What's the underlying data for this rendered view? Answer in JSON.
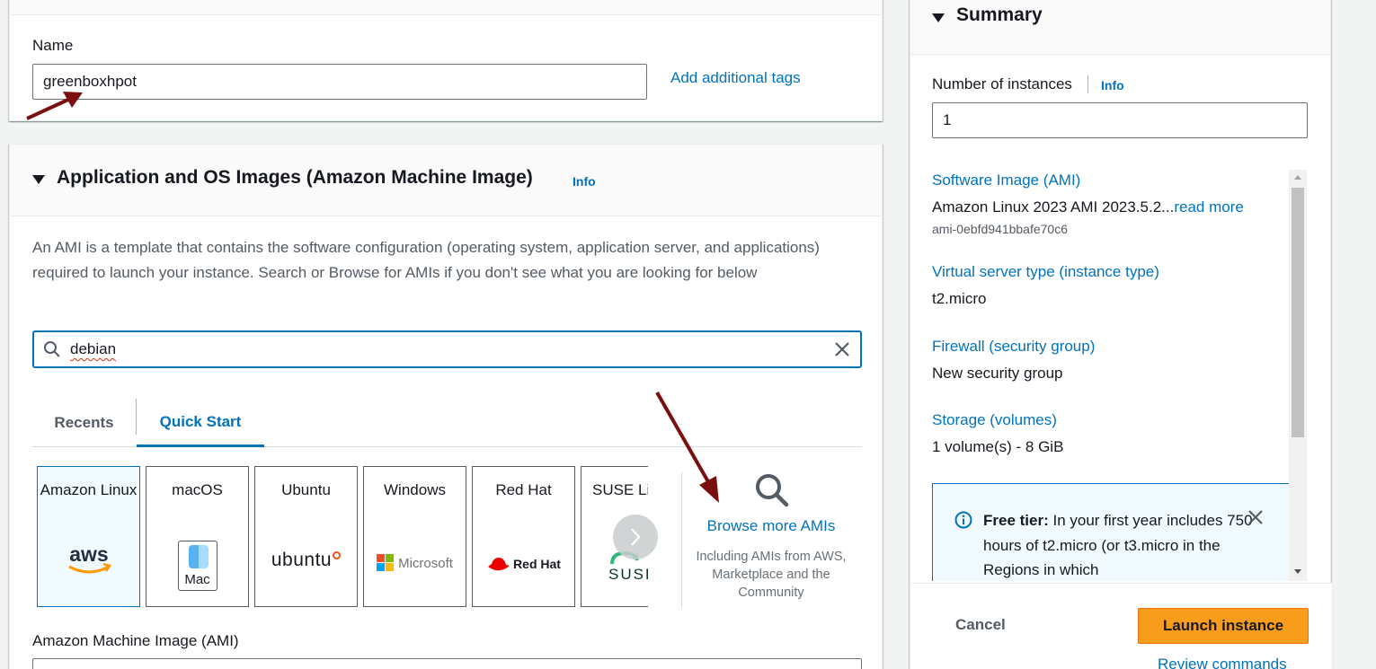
{
  "name_section": {
    "label": "Name",
    "value": "greenboxhpot",
    "add_tags_link": "Add additional tags"
  },
  "ami_section": {
    "title": "Application and OS Images (Amazon Machine Image)",
    "info": "Info",
    "description": "An AMI is a template that contains the software configuration (operating system, application server, and applications) required to launch your instance. Search or Browse for AMIs if you don't see what you are looking for below",
    "search_value": "debian",
    "tabs": [
      {
        "label": "Recents",
        "active": false
      },
      {
        "label": "Quick Start",
        "active": true
      }
    ],
    "tiles": [
      {
        "name": "Amazon Linux",
        "logo": "aws-logo",
        "selected": true
      },
      {
        "name": "macOS",
        "logo": "mac-logo",
        "logo_text": "Mac",
        "selected": false
      },
      {
        "name": "Ubuntu",
        "logo": "ubuntu-logo",
        "logo_text": "ubuntu",
        "selected": false
      },
      {
        "name": "Windows",
        "logo": "microsoft-logo",
        "logo_text": "Microsoft",
        "selected": false
      },
      {
        "name": "Red Hat",
        "logo": "redhat-logo",
        "logo_text": "Red Hat",
        "selected": false
      },
      {
        "name": "SUSE Li",
        "logo": "suse-logo",
        "logo_text": "SUSE",
        "selected": false
      }
    ],
    "aws_logo_text": "aws",
    "browse_link": "Browse more AMIs",
    "browse_sub": "Including AMIs from AWS, Marketplace and the Community",
    "ami_label": "Amazon Machine Image (AMI)"
  },
  "summary": {
    "title": "Summary",
    "instances_label": "Number of instances",
    "instances_info": "Info",
    "instances_value": "1",
    "items": [
      {
        "title": "Software Image (AMI)",
        "value": "Amazon Linux 2023 AMI 2023.5.2...",
        "value_link": "read more",
        "sub": "ami-0ebfd941bbafe70c6"
      },
      {
        "title": "Virtual server type (instance type)",
        "value": "t2.micro"
      },
      {
        "title": "Firewall (security group)",
        "value": "New security group"
      },
      {
        "title": "Storage (volumes)",
        "value": "1 volume(s) - 8 GiB"
      }
    ],
    "free_tier_label": "Free tier:",
    "free_tier_text": "In your first year includes 750 hours of t2.micro (or t3.micro in the Regions in which",
    "cancel": "Cancel",
    "launch": "Launch instance",
    "review": "Review commands"
  },
  "colors": {
    "link": "#0073bb",
    "launch_button": "#f89c1c",
    "annotation_arrow": "#7a0f0f"
  }
}
